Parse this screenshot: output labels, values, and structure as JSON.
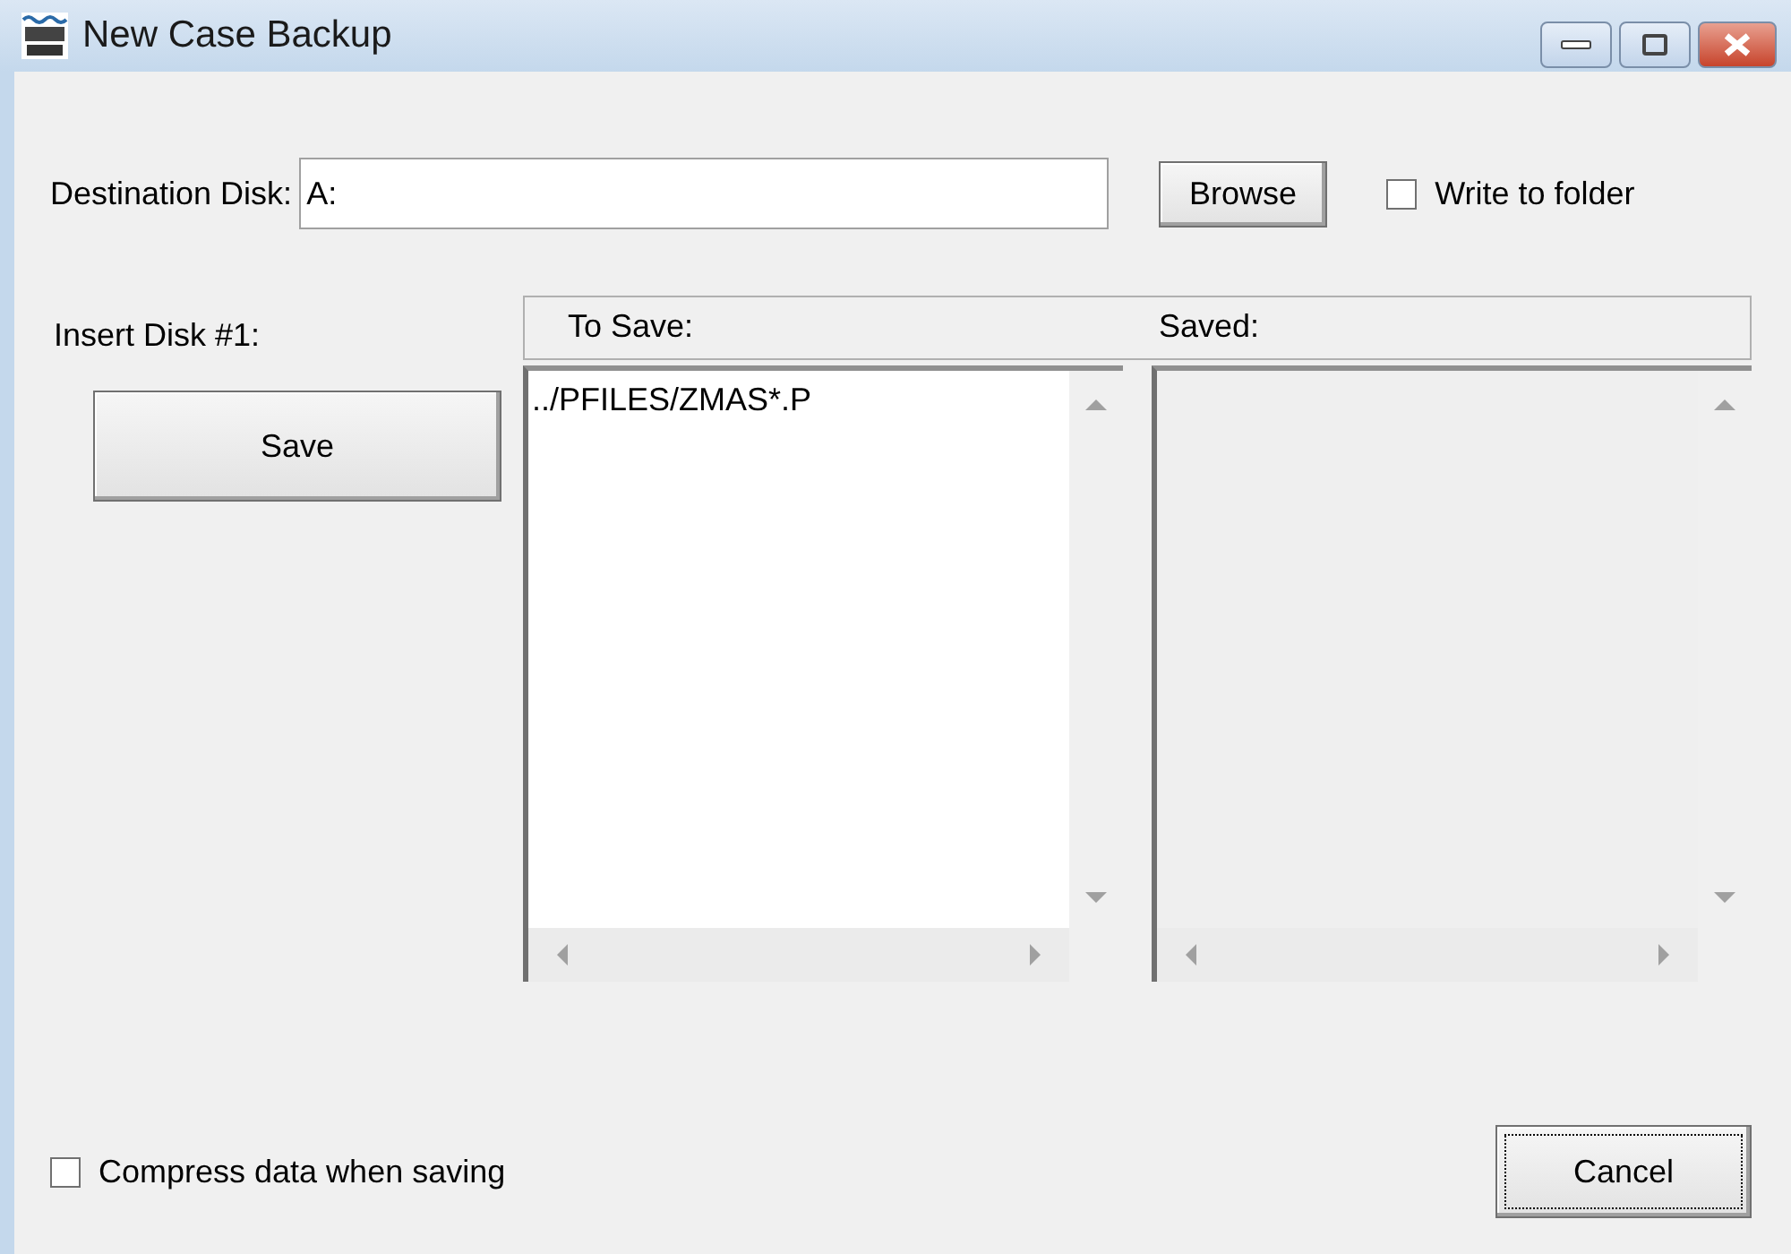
{
  "window": {
    "title": "New Case Backup"
  },
  "destination": {
    "label": "Destination Disk:",
    "value": "A:"
  },
  "browse_button": "Browse",
  "write_to_folder": {
    "label": "Write to folder",
    "checked": false
  },
  "insert_disk_label": "Insert Disk #1:",
  "save_button": "Save",
  "lists": [
    {
      "header": "To Save:",
      "items": [
        "../PFILES/ZMAS*.P"
      ],
      "disabled": false
    },
    {
      "header": "Saved:",
      "disabled": true
    }
  ],
  "compress": {
    "label": "Compress data when saving",
    "checked": false
  },
  "cancel_button": "Cancel"
}
